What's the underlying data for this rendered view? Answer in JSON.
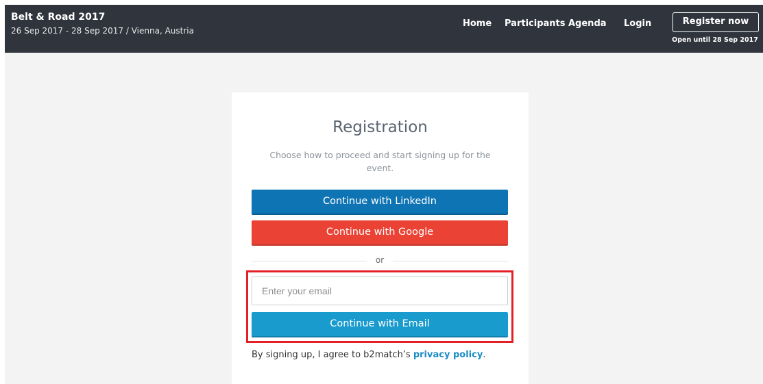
{
  "header": {
    "event_title": "Belt & Road 2017",
    "event_subtitle": "26 Sep 2017 - 28 Sep 2017 / Vienna, Austria",
    "nav": {
      "home": "Home",
      "participants": "Participants",
      "agenda": "Agenda",
      "login": "Login"
    },
    "register_button": "Register now",
    "register_note": "Open until 28 Sep 2017"
  },
  "registration": {
    "title": "Registration",
    "description": "Choose how to proceed and start signing up for the event.",
    "linkedin_button": "Continue with LinkedIn",
    "google_button": "Continue with Google",
    "divider_text": "or",
    "email_placeholder": "Enter your email",
    "email_value": "",
    "email_button": "Continue with Email",
    "policy_prefix": "By signing up, I agree to b2match’s ",
    "policy_link": "privacy policy",
    "policy_suffix": "."
  },
  "colors": {
    "header_bg": "#2f343d",
    "linkedin": "#0e74b4",
    "google": "#ea4335",
    "email": "#1a9bce",
    "highlight": "#e41f25",
    "link": "#1a8bc4"
  }
}
